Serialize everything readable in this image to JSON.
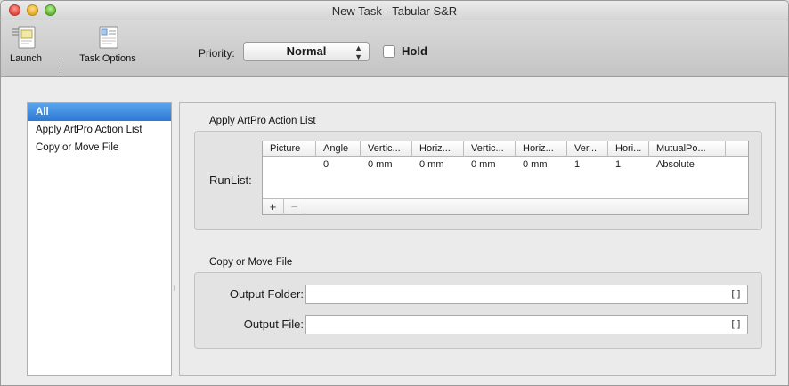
{
  "window": {
    "title": "New Task - Tabular S&R"
  },
  "toolbar": {
    "launch_label": "Launch",
    "task_options_label": "Task Options",
    "priority_label": "Priority:",
    "priority_value": "Normal",
    "hold_label": "Hold",
    "hold_checked": false
  },
  "sidebar": {
    "items": [
      {
        "label": "All",
        "selected": true
      },
      {
        "label": "Apply ArtPro Action List",
        "selected": false
      },
      {
        "label": "Copy or Move File",
        "selected": false
      }
    ]
  },
  "action_list": {
    "section_title": "Apply ArtPro Action List",
    "runlist_label": "RunList:",
    "columns": [
      "Picture",
      "Angle",
      "Vertic...",
      "Horiz...",
      "Vertic...",
      "Horiz...",
      "Ver...",
      "Hori...",
      "MutualPo..."
    ],
    "rows": [
      [
        "",
        "0",
        "0 mm",
        "0 mm",
        "0 mm",
        "0 mm",
        "1",
        "1",
        "Absolute"
      ]
    ],
    "add_label": "+",
    "remove_label": "−"
  },
  "copy_move": {
    "section_title": "Copy or Move File",
    "output_folder_label": "Output Folder:",
    "output_folder_value": "",
    "output_file_label": "Output File:",
    "output_file_value": "",
    "browse_glyph": "[]"
  }
}
